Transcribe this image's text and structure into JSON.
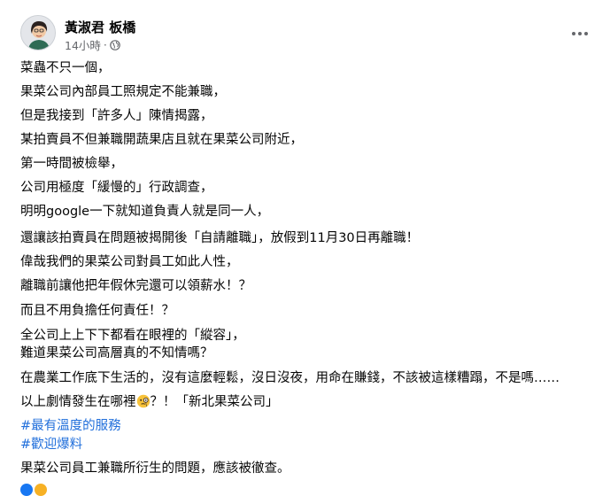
{
  "post": {
    "author": "黃淑君 板橋",
    "time": "14小時",
    "time_separator": "·",
    "lines": [
      "菜蟲不只一個，",
      "果菜公司內部員工照規定不能兼職，",
      "但是我接到「許多人」陳情揭露，",
      "某拍賣員不但兼職開蔬果店且就在果菜公司附近，",
      "第一時間被檢舉，",
      "公司用極度「緩慢的」行政調查，",
      "明明google一下就知道負責人就是同一人，",
      "還讓該拍賣員在問題被揭開後「自請離職」，放假到11月30日再離職！",
      "偉哉我們的果菜公司對員工如此人性，",
      "離職前讓他把年假休完還可以領薪水！？",
      "而且不用負擔任何責任！？",
      "全公司上上下下都看在眼裡的「縱容」，",
      "難道果菜公司高層真的不知情嗎？",
      "在農業工作底下生活的，沒有這麼輕鬆，沒日沒夜，用命在賺錢，不該被這樣糟蹋，不是嗎……"
    ],
    "last_line_before_emoji": "以上劇情發生在哪裡",
    "last_line_after_emoji": "？！「新北果菜公司」",
    "emoji_name": "monocle-face-emoji",
    "hashtags": [
      "#最有溫度的服務",
      "#歡迎爆料"
    ],
    "closing": "果菜公司員工兼職所衍生的問題，應該被徹查。"
  },
  "icons": {
    "privacy": "globe-icon",
    "more": "more-options-icon"
  },
  "colors": {
    "hashtag": "#216fdb",
    "meta_text": "#65676b",
    "text": "#050505"
  }
}
